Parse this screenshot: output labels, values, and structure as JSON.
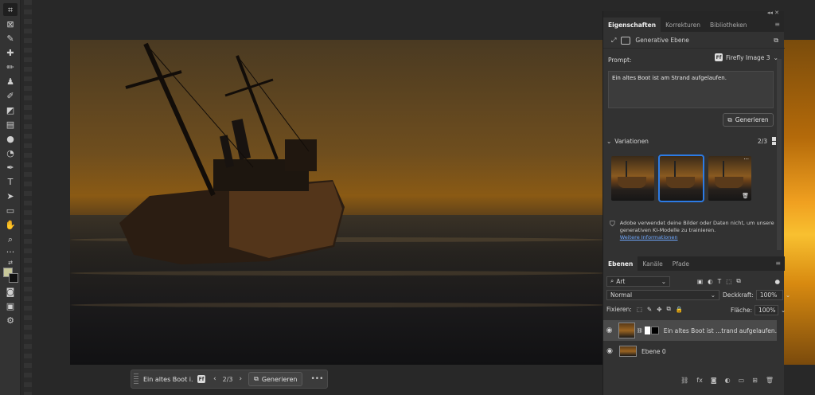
{
  "properties_panel": {
    "tabs": [
      "Eigenschaften",
      "Korrekturen",
      "Bibliotheken"
    ],
    "layer_type": "Generative Ebene",
    "prompt_label": "Prompt:",
    "model": "Firefly Image 3",
    "model_badge": "Ff",
    "prompt_text": "Ein altes Boot ist am Strand aufgelaufen.",
    "generate_label": "Generieren",
    "variations_label": "Variationen",
    "variations_count": "2/3",
    "notice_text": "Adobe verwendet deine Bilder oder Daten nicht, um unsere generativen KI-Modelle zu trainieren.",
    "notice_link": "Weitere Informationen"
  },
  "layers_panel": {
    "tabs": [
      "Ebenen",
      "Kanäle",
      "Pfade"
    ],
    "filter": "Art",
    "blend_mode": "Normal",
    "opacity_label": "Deckkraft:",
    "opacity_value": "100%",
    "lock_label": "Fixieren:",
    "fill_label": "Fläche:",
    "fill_value": "100%",
    "layers": [
      {
        "name": "Ein altes Boot ist ...trand aufgelaufen.",
        "selected": true
      },
      {
        "name": "Ebene 0",
        "selected": false
      }
    ]
  },
  "context_bar": {
    "prompt_short": "Ein altes Boot i...",
    "badge": "Ff",
    "prev": "‹",
    "next": "›",
    "count": "2/3",
    "generate_label": "Generieren",
    "more": "•••"
  },
  "colors": {
    "accent": "#2c7be5",
    "panel_bg": "#323232",
    "app_bg": "#282828"
  }
}
